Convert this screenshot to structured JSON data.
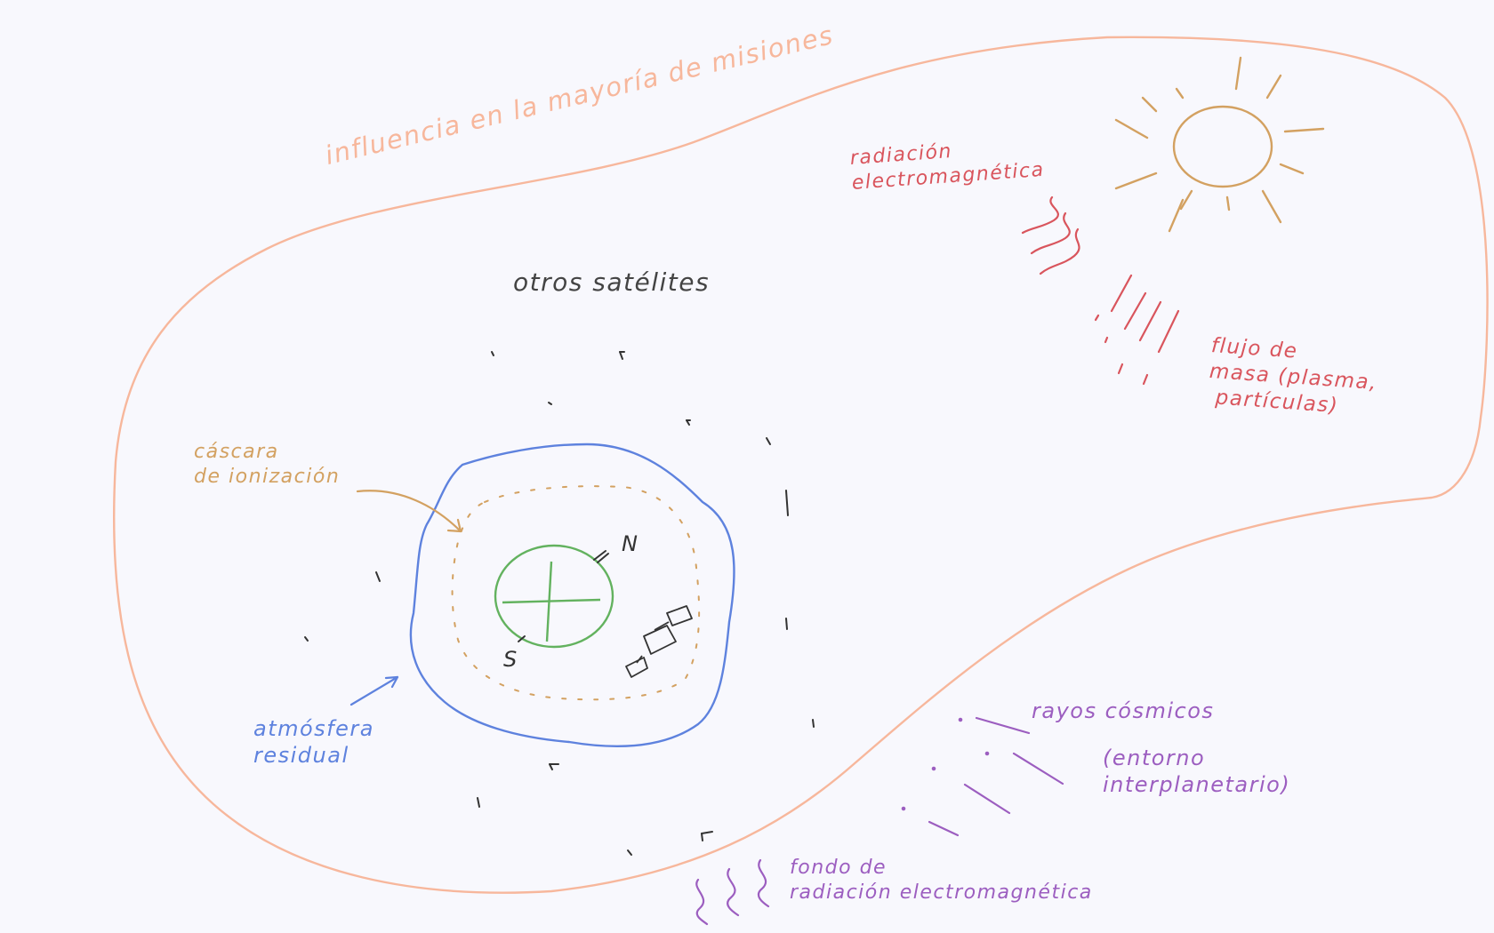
{
  "labels": {
    "influence_zone": "influencia en la mayoría de misiones",
    "other_satellites": "otros satélites",
    "ionization_shell": "cáscara\nde ionización",
    "residual_atmosphere": "atmósfera\nresidual",
    "electromagnetic_radiation": "radiación\nelectromagnética",
    "mass_flow": "flujo de\nmasa (plasma,\n partículas)",
    "cosmic_rays": "rayos cósmicos",
    "interplanetary_environment": "(entorno\ninterplanetario)",
    "background_radiation": "fondo de\nradiación electromagnética",
    "north_pole": "N",
    "south_pole": "S"
  },
  "colors": {
    "background": "#f8f8fd",
    "influence_zone": "#f7b79c",
    "ionization_shell": "#d3a161",
    "residual_atmosphere": "#5e82de",
    "earth": "#63b25f",
    "sun": "#d3a161",
    "radiation": "#d9555d",
    "cosmic": "#9c5ec0",
    "satellites": "#333333"
  },
  "icons": {
    "sun": "sun-icon",
    "earth": "earth-icon",
    "spacecraft": "satellite-icon"
  }
}
